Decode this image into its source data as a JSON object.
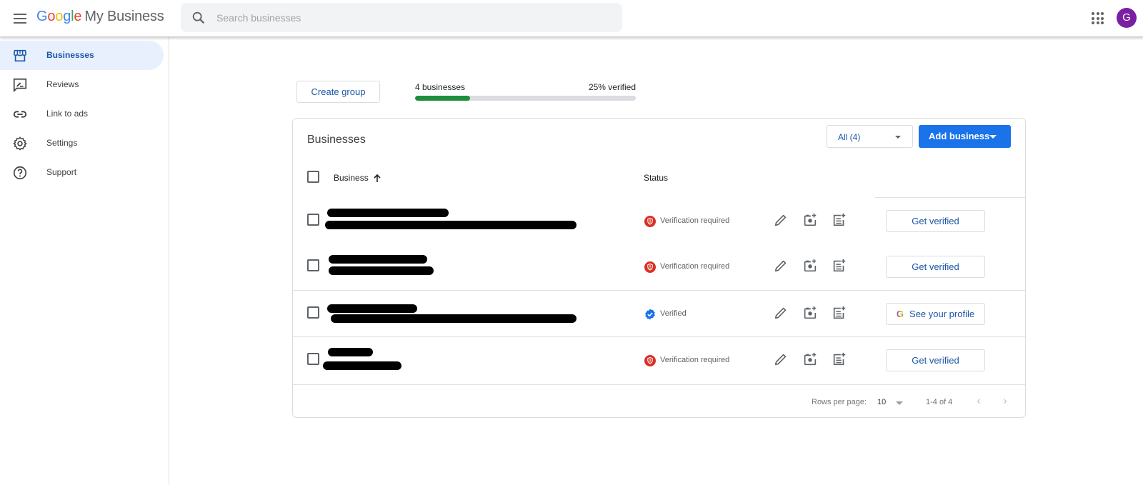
{
  "header": {
    "app_logo_letters": [
      "G",
      "o",
      "o",
      "g",
      "l",
      "e"
    ],
    "app_product": "My Business",
    "search_placeholder": "Search businesses",
    "search_value": "",
    "avatar_initial": "G",
    "avatar_color": "#7b1fa2"
  },
  "sidebar": {
    "items": [
      {
        "label": "Businesses",
        "icon": "storefront-icon",
        "active": true
      },
      {
        "label": "Reviews",
        "icon": "rate-review-icon",
        "active": false
      },
      {
        "label": "Link to ads",
        "icon": "link-icon",
        "active": false
      },
      {
        "label": "Settings",
        "icon": "gear-icon",
        "active": false
      },
      {
        "label": "Support",
        "icon": "help-icon",
        "active": false
      }
    ]
  },
  "summary": {
    "create_group_label": "Create group",
    "business_count_label": "4 businesses",
    "verified_label": "25% verified",
    "verified_fraction": 0.25,
    "progress_color": "#1e8e3e"
  },
  "card": {
    "title": "Businesses",
    "filter_value": "All (4)",
    "add_business_label": "Add business",
    "columns": {
      "business": "Business",
      "status": "Status"
    },
    "sort": "ascending",
    "rows": [
      {
        "name": "[redacted]",
        "address": "[redacted]",
        "status": "Verification required",
        "status_type": "warning",
        "action_label": "Get verified",
        "action_icon": ""
      },
      {
        "name": "[redacted]",
        "address": "[redacted]",
        "status": "Verification required",
        "status_type": "warning",
        "action_label": "Get verified",
        "action_icon": ""
      },
      {
        "name": "[redacted]",
        "address": "[redacted]",
        "status": "Verified",
        "status_type": "verified",
        "action_label": "See your profile",
        "action_icon": "G"
      },
      {
        "name": "[redacted]",
        "address": "[redacted]",
        "status": "Verification required",
        "status_type": "warning",
        "action_label": "Get verified",
        "action_icon": ""
      }
    ],
    "footer": {
      "rows_per_page_label": "Rows per page:",
      "rows_per_page_value": "10",
      "range_label": "1-4 of 4",
      "prev_glyph": "‹",
      "next_glyph": "›"
    }
  },
  "colors": {
    "accent": "#1a73e8",
    "link_text": "#1a57a6",
    "warning": "#d93025",
    "verified": "#1a73e8"
  }
}
